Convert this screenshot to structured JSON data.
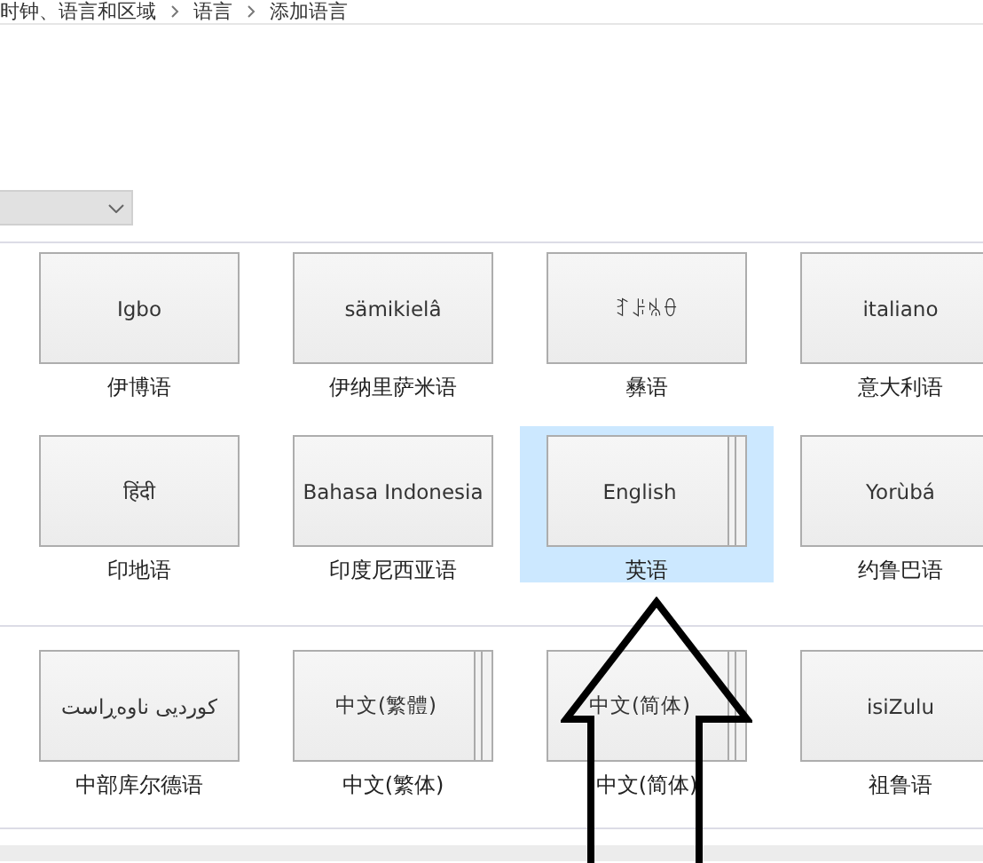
{
  "breadcrumb": [
    "时钟、语言和区域",
    "语言",
    "添加语言"
  ],
  "language_groups": [
    {
      "rows": [
        [
          {
            "native_name": "Igbo",
            "label": "伊博语",
            "stacked": false,
            "selected": false
          },
          {
            "native_name": "sämikielâ",
            "label": "伊纳里萨米语",
            "stacked": false,
            "selected": false
          },
          {
            "native_name": "ꆈꌠꁱꂷ",
            "label": "彝语",
            "stacked": false,
            "selected": false
          },
          {
            "native_name": "italiano",
            "label": "意大利语",
            "stacked": false,
            "selected": false
          }
        ],
        [
          {
            "native_name": "हिंदी",
            "label": "印地语",
            "stacked": false,
            "selected": false
          },
          {
            "native_name": "Bahasa Indonesia",
            "label": "印度尼西亚语",
            "stacked": false,
            "selected": false
          },
          {
            "native_name": "English",
            "label": "英语",
            "stacked": true,
            "selected": true
          },
          {
            "native_name": "Yorùbá",
            "label": "约鲁巴语",
            "stacked": false,
            "selected": false
          }
        ]
      ]
    },
    {
      "rows": [
        [
          {
            "native_name": "کوردیی ناوەڕاست",
            "label": "中部库尔德语",
            "stacked": false,
            "selected": false
          },
          {
            "native_name": "中文(繁體)",
            "label": "中文(繁体)",
            "stacked": true,
            "selected": false
          },
          {
            "native_name": "中文(简体)",
            "label": "中文(简体)",
            "stacked": true,
            "selected": false
          },
          {
            "native_name": "isiZulu",
            "label": "祖鲁语",
            "stacked": false,
            "selected": false
          }
        ]
      ]
    }
  ]
}
